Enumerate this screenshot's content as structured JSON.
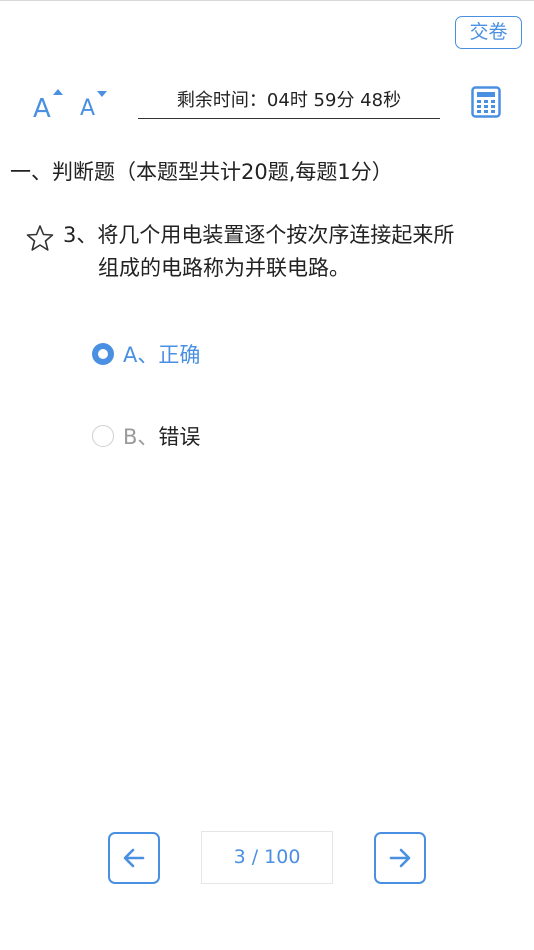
{
  "header": {
    "submit_label": "交卷",
    "timer_text": "剩余时间：04时 59分 48秒",
    "font_increase_letter": "A",
    "font_decrease_letter": "A",
    "calculator_icon": "calculator-icon"
  },
  "section": {
    "title": "一、判断题（本题型共计20题,每题1分）"
  },
  "question": {
    "number": "3、",
    "text_line1": "将几个用电装置逐个按次序连接起来所",
    "text_line2": "组成的电路称为并联电路。",
    "favorite_icon": "star-icon"
  },
  "options": [
    {
      "letter": "A、",
      "label": "正确",
      "selected": true
    },
    {
      "letter": "B、",
      "label": "错误",
      "selected": false
    }
  ],
  "pagination": {
    "indicator": "3 / 100",
    "prev_icon": "arrow-left-icon",
    "next_icon": "arrow-right-icon"
  },
  "colors": {
    "accent": "#4a90e2",
    "text": "#222222",
    "muted": "#9a9a9a"
  }
}
